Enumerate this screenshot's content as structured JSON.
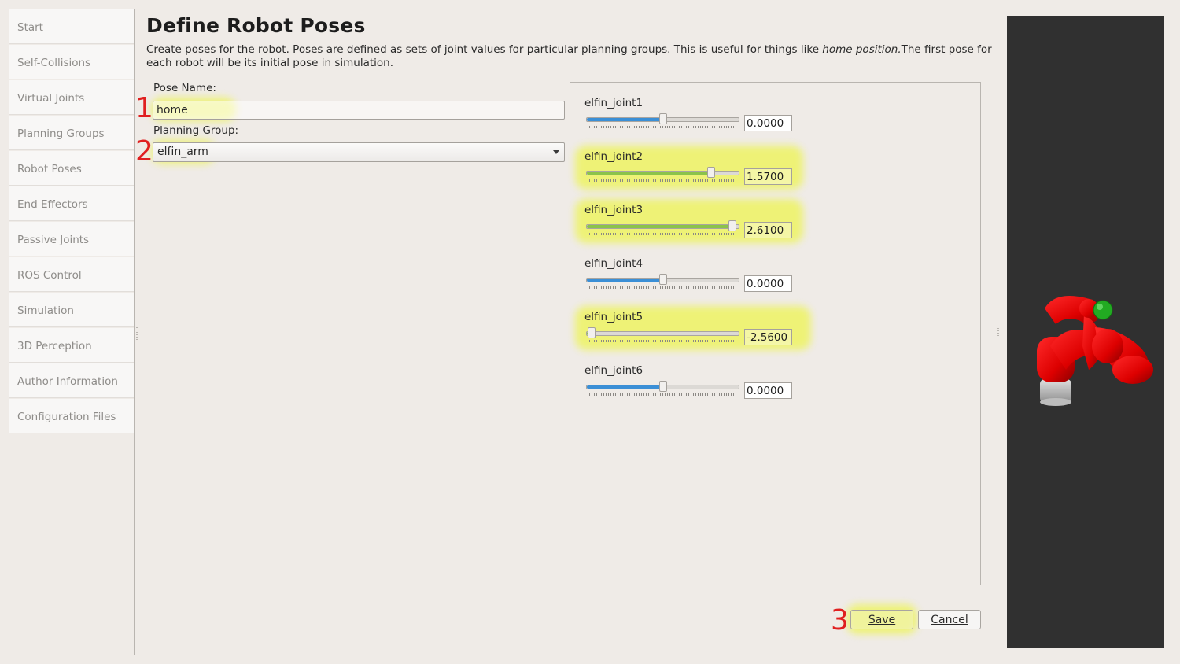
{
  "sidebar": {
    "items": [
      {
        "label": "Start"
      },
      {
        "label": "Self-Collisions"
      },
      {
        "label": "Virtual Joints"
      },
      {
        "label": "Planning Groups"
      },
      {
        "label": "Robot Poses"
      },
      {
        "label": "End Effectors"
      },
      {
        "label": "Passive Joints"
      },
      {
        "label": "ROS Control"
      },
      {
        "label": "Simulation"
      },
      {
        "label": "3D Perception"
      },
      {
        "label": "Author Information"
      },
      {
        "label": "Configuration Files"
      }
    ]
  },
  "header": {
    "title": "Define Robot Poses",
    "description_part1": "Create poses for the robot. Poses are defined as sets of joint values for particular planning groups. This is useful for things like ",
    "description_italic": "home position.",
    "description_part2": "The first pose for each robot will be its initial pose in simulation."
  },
  "form": {
    "pose_name_label": "Pose Name:",
    "pose_name_value": "home",
    "planning_group_label": "Planning Group:",
    "planning_group_value": "elfin_arm"
  },
  "joints": [
    {
      "name": "elfin_joint1",
      "value": "0.0000",
      "slider_fraction": 0.5,
      "highlighted": false
    },
    {
      "name": "elfin_joint2",
      "value": "1.5700",
      "slider_fraction": 0.82,
      "highlighted": true
    },
    {
      "name": "elfin_joint3",
      "value": "2.6100",
      "slider_fraction": 0.96,
      "highlighted": true
    },
    {
      "name": "elfin_joint4",
      "value": "0.0000",
      "slider_fraction": 0.5,
      "highlighted": false
    },
    {
      "name": "elfin_joint5",
      "value": "-2.5600",
      "slider_fraction": 0.03,
      "highlighted": true
    },
    {
      "name": "elfin_joint6",
      "value": "0.0000",
      "slider_fraction": 0.5,
      "highlighted": false
    }
  ],
  "annotations": {
    "step1": "1",
    "step2": "2",
    "step3": "3"
  },
  "buttons": {
    "save_label": "Save",
    "cancel_label": "Cancel"
  },
  "colors": {
    "highlight": "#eef36a",
    "slider_fill": "#3b8fd6",
    "highlighted_slider_fill": "#8bc34a",
    "annotation": "#e02020",
    "robot": "#e00000",
    "end_effector_marker": "#22aa22",
    "viewer_bg": "#303030"
  },
  "icons": {
    "dropdown": "chevron-down-icon",
    "robot": "robot-arm-model"
  }
}
